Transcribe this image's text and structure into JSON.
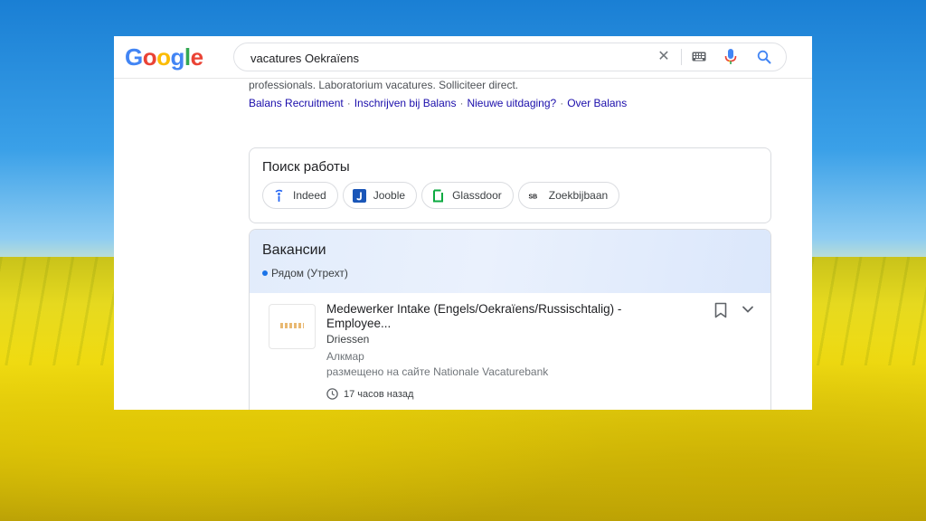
{
  "search": {
    "query": "vacatures Oekraïens"
  },
  "logo": {
    "letters": [
      "G",
      "o",
      "o",
      "g",
      "l",
      "e"
    ]
  },
  "result": {
    "snippet": "professionals. Laboratorium vacatures. Solliciteer direct.",
    "sitelinks": [
      "Balans Recruitment",
      "Inschrijven bij Balans",
      "Nieuwe uitdaging?",
      "Over Balans"
    ],
    "sitelink_separator": "·"
  },
  "job_search": {
    "title": "Поиск работы",
    "chips": [
      {
        "label": "Indeed",
        "icon": "indeed-icon"
      },
      {
        "label": "Jooble",
        "icon": "jooble-icon"
      },
      {
        "label": "Glassdoor",
        "icon": "glassdoor-icon"
      },
      {
        "label": "Zoekbijbaan",
        "icon": "zoekbijbaan-icon"
      }
    ],
    "zoekbijbaan_badge": "SB"
  },
  "vacancies": {
    "title": "Вакансии",
    "location": "Рядом (Утрехт)",
    "job": {
      "title": "Medewerker Intake (Engels/Oekraïens/Russischtalig) - Employee...",
      "company": "Driessen",
      "city": "Алкмар",
      "source": "размещено на сайте Nationale Vacaturebank",
      "posted": "17 часов назад"
    }
  },
  "colors": {
    "link": "#1a0dab",
    "accent_blue": "#1a73e8",
    "google_blue": "#4285f4",
    "google_red": "#ea4335",
    "google_yellow": "#fbbc05",
    "google_green": "#34a853"
  }
}
